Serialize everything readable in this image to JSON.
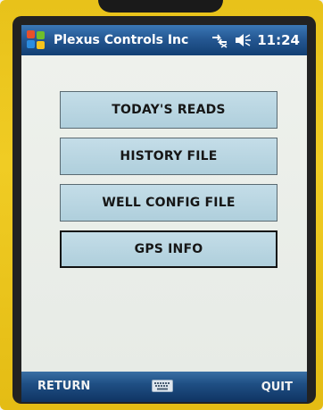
{
  "titlebar": {
    "app_title": "Plexus Controls Inc",
    "time": "11:24",
    "icons": [
      "windows-start-icon",
      "connectivity-icon",
      "volume-muted-icon"
    ]
  },
  "menu": {
    "items": [
      {
        "label": "TODAY'S READS"
      },
      {
        "label": "HISTORY FILE"
      },
      {
        "label": "WELL CONFIG FILE"
      },
      {
        "label": "GPS INFO"
      }
    ]
  },
  "softkeys": {
    "left": "RETURN",
    "right": "QUIT",
    "center_icon": "keyboard-icon"
  },
  "colors": {
    "titlebar": "#255893",
    "button_fill": "#b8d6e2",
    "device_body": "#ecc520"
  }
}
